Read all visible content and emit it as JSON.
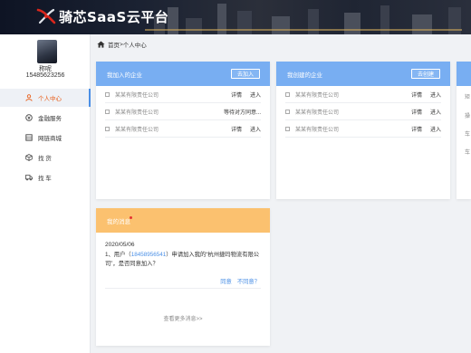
{
  "header": {
    "brand": "骑芯SaaS云平台",
    "logo_icon": "bird-logo-icon",
    "colors": {
      "bar": "#1b2232",
      "logo": "#d9261c"
    }
  },
  "sidebar": {
    "user_name": "称呢",
    "user_phone": "15485623256",
    "items": [
      {
        "label": "个人中心",
        "icon": "user-icon",
        "active": true
      },
      {
        "label": "金融服务",
        "icon": "finance-icon"
      },
      {
        "label": "网链商城",
        "icon": "store-icon"
      },
      {
        "label": "找 货",
        "icon": "box-icon"
      },
      {
        "label": "找 车",
        "icon": "truck-icon"
      }
    ],
    "active_color": "#e85a14"
  },
  "breadcrumb": {
    "home": "首页",
    "separator": ">",
    "current": "个人中心"
  },
  "cards": {
    "joined": {
      "title": "我加入的企业",
      "button": "去加入",
      "rows": [
        {
          "name": "某某有限责任公司",
          "action1": "详情",
          "action2": "进入"
        },
        {
          "name": "某某有限责任公司",
          "action1": "等待对方同意...",
          "action2": ""
        },
        {
          "name": "某某有限责任公司",
          "action1": "详情",
          "action2": "进入"
        }
      ]
    },
    "created": {
      "title": "我创建的企业",
      "button": "去创建",
      "rows": [
        {
          "name": "某某有限责任公司",
          "action1": "详情",
          "action2": "进入"
        },
        {
          "name": "某某有限责任公司",
          "action1": "详情",
          "action2": "进入"
        },
        {
          "name": "某某有限责任公司",
          "action1": "详情",
          "action2": "进入"
        }
      ]
    },
    "partial": {
      "rows": [
        "矩",
        "操",
        "车",
        "车"
      ]
    },
    "messages": {
      "title": "我的消息",
      "date": "2020/05/06",
      "text_prefix": "1、用户（",
      "phone": "18458956541",
      "text_suffix": "）申请加入我的“杭州捷玛物流有限公司”，是否同意加入？",
      "agree": "同意",
      "disagree": "不同意？",
      "more": "查看更多消息>>"
    }
  },
  "colors": {
    "blue_header": "#78aef2",
    "orange_header": "#fbc16f",
    "link": "#4a8fe6"
  }
}
